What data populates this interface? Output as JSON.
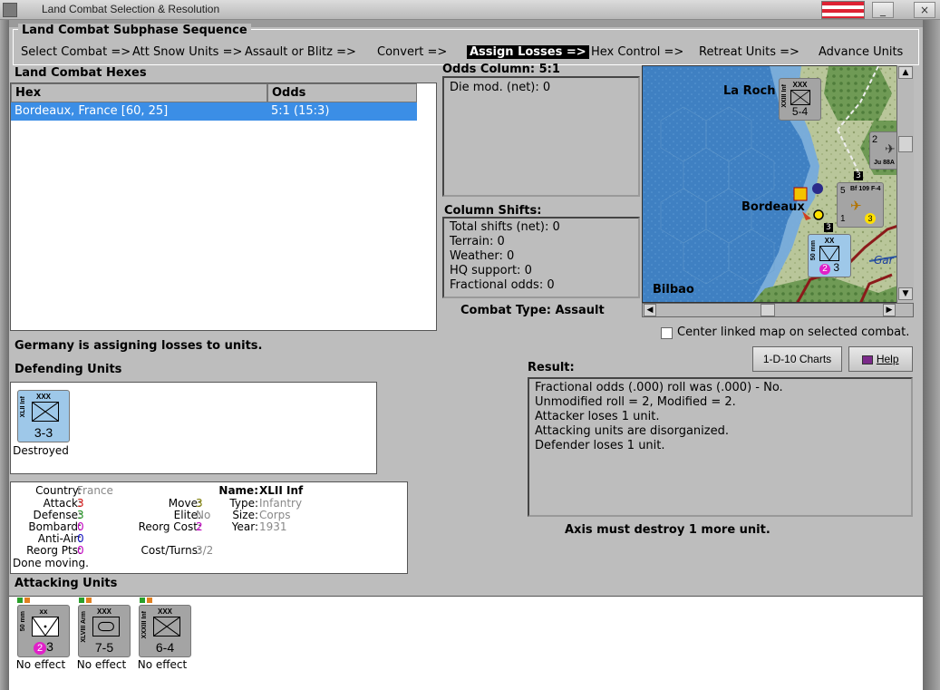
{
  "window": {
    "title": "Land Combat Selection & Resolution",
    "minimize": "_",
    "close": "×"
  },
  "sequence": {
    "title": "Land Combat Subphase Sequence",
    "steps": [
      "Select Combat =>",
      "Att Snow Units =>",
      "Assault or Blitz =>",
      "Convert =>",
      "Assign Losses =>",
      "Hex Control =>",
      "Retreat Units =>",
      "Advance Units"
    ],
    "active_step": "Assign Losses =>"
  },
  "hexes": {
    "title": "Land Combat Hexes",
    "columns": [
      "Hex",
      "Odds"
    ],
    "rows": [
      {
        "hex": "Bordeaux, France [60, 25]",
        "odds": "5:1 (15:3)"
      }
    ]
  },
  "odds": {
    "title": "Odds Column: 5:1",
    "die_mod": "Die mod. (net): 0"
  },
  "shifts": {
    "title": "Column Shifts:",
    "lines": [
      "Total shifts (net): 0",
      "Terrain: 0",
      "Weather: 0",
      "HQ support: 0",
      "Fractional odds: 0"
    ]
  },
  "combat_type": "Combat Type:  Assault",
  "map": {
    "labels": {
      "la_rochelle": "La Roch",
      "bordeaux": "Bordeaux",
      "bilbao": "Bilbao",
      "garonne": "Gar"
    },
    "units": [
      {
        "name": "XXIII Inf",
        "size": "XXX",
        "strength": "5-4"
      },
      {
        "name": "Bf 109 F-4",
        "strength_left": "5",
        "strength_right": "1",
        "badge": "3",
        "stack": "3"
      },
      {
        "name": "Ju 88A",
        "strength": "2"
      },
      {
        "name": "50 mm",
        "size": "XX",
        "strength": "3",
        "badge": "2",
        "stack": "3"
      }
    ]
  },
  "center_checkbox": "Center linked map on selected combat.",
  "buttons": {
    "charts": "1-D-10 Charts",
    "help": "Help"
  },
  "status_message": "Germany is assigning losses to units.",
  "defending": {
    "title": "Defending Units",
    "units": [
      {
        "name": "XLII Inf",
        "size": "XXX",
        "strength": "3-3",
        "status": "Destroyed"
      }
    ]
  },
  "unit_info": {
    "country_label": "Country:",
    "country": "France",
    "attack_label": "Attack:",
    "attack": "3",
    "defense_label": "Defense:",
    "defense": "3",
    "bombard_label": "Bombard:",
    "bombard": "0",
    "antiair_label": "Anti-Air:",
    "antiair": "0",
    "reorgpts_label": "Reorg Pts:",
    "reorgpts": "0",
    "move_label": "Move:",
    "move": "3",
    "elite_label": "Elite:",
    "elite": "No",
    "reorgcost_label": "Reorg Cost:",
    "reorgcost": "2",
    "costturns_label": "Cost/Turns:",
    "costturns": "3/2",
    "name_label": "Name:",
    "name": "XLII Inf",
    "type_label": "Type:",
    "type": "Infantry",
    "size_label": "Size:",
    "size": "Corps",
    "year_label": "Year:",
    "year": "1931",
    "done": "Done moving."
  },
  "result": {
    "title": "Result:",
    "lines": [
      "Fractional odds (.000) roll was (.000)  - No.",
      "Unmodified roll = 2, Modified = 2.",
      "Attacker loses 1 unit.",
      "Attacking units are disorganized.",
      "Defender loses 1 unit."
    ],
    "summary": "Axis must destroy 1 more unit."
  },
  "attacking": {
    "title": "Attacking Units",
    "units": [
      {
        "name": "50 mm",
        "size": "xx",
        "badge": "2",
        "strength": "3",
        "status": "No effect"
      },
      {
        "name": "XLVIII Arm",
        "size": "XXX",
        "strength": "7-5",
        "status": "No effect"
      },
      {
        "name": "XXXIII Inf",
        "size": "XXX",
        "strength": "6-4",
        "status": "No effect"
      }
    ]
  },
  "colors": {
    "selection": "#3b8ee6",
    "attack_value": "#d01010",
    "defense_value": "#1a8a1a",
    "bombard_value": "#c000c0",
    "antiair_value": "#1010c0",
    "badge": "#e020c8"
  }
}
